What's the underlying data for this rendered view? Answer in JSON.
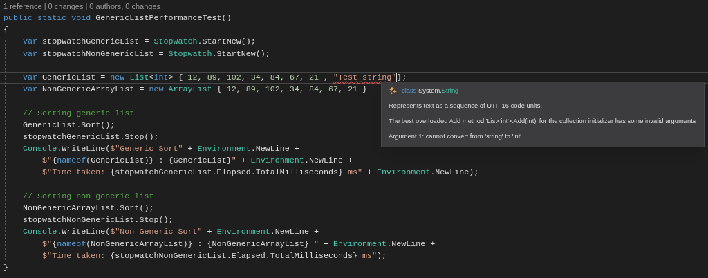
{
  "codelens": "1 reference | 0 changes | 0 authors, 0 changes",
  "lines": [
    {
      "kind": "code",
      "tokens": [
        {
          "kind": "kw",
          "text": "public static void "
        },
        {
          "kind": "plain",
          "text": "GenericListPerformanceTest()"
        }
      ]
    },
    {
      "kind": "code",
      "tokens": [
        {
          "kind": "plain",
          "text": "{"
        }
      ]
    },
    {
      "kind": "code",
      "tokens": [
        {
          "kind": "kw",
          "text": "    var "
        },
        {
          "kind": "plain",
          "text": "stopwatchGenericList = "
        },
        {
          "kind": "type",
          "text": "Stopwatch"
        },
        {
          "kind": "plain",
          "text": ".StartNew();"
        }
      ]
    },
    {
      "kind": "code",
      "tokens": [
        {
          "kind": "kw",
          "text": "    var "
        },
        {
          "kind": "plain",
          "text": "stopwatchNonGenericList = "
        },
        {
          "kind": "type",
          "text": "Stopwatch"
        },
        {
          "kind": "plain",
          "text": ".StartNew();"
        }
      ]
    },
    {
      "kind": "blank"
    },
    {
      "kind": "code",
      "current": true,
      "tokens": [
        {
          "kind": "kw",
          "text": "    var "
        },
        {
          "kind": "plain",
          "text": "GenericList = "
        },
        {
          "kind": "kw",
          "text": "new "
        },
        {
          "kind": "type",
          "text": "List"
        },
        {
          "kind": "plain",
          "text": "<"
        },
        {
          "kind": "kw",
          "text": "int"
        },
        {
          "kind": "plain",
          "text": "> { "
        },
        {
          "kind": "num",
          "text": "12"
        },
        {
          "kind": "plain",
          "text": ", "
        },
        {
          "kind": "num",
          "text": "89"
        },
        {
          "kind": "plain",
          "text": ", "
        },
        {
          "kind": "num",
          "text": "102"
        },
        {
          "kind": "plain",
          "text": ", "
        },
        {
          "kind": "num",
          "text": "34"
        },
        {
          "kind": "plain",
          "text": ", "
        },
        {
          "kind": "num",
          "text": "84"
        },
        {
          "kind": "plain",
          "text": ", "
        },
        {
          "kind": "num",
          "text": "67"
        },
        {
          "kind": "plain",
          "text": ", "
        },
        {
          "kind": "num",
          "text": "21"
        },
        {
          "kind": "plain",
          "text": " , "
        },
        {
          "kind": "error",
          "text": "\"Test string\""
        },
        {
          "kind": "plain",
          "text": "};"
        }
      ]
    },
    {
      "kind": "code",
      "tokens": [
        {
          "kind": "kw",
          "text": "    var "
        },
        {
          "kind": "plain",
          "text": "NonGenericArrayList = "
        },
        {
          "kind": "kw",
          "text": "new "
        },
        {
          "kind": "type",
          "text": "ArrayList"
        },
        {
          "kind": "plain",
          "text": " { "
        },
        {
          "kind": "num",
          "text": "12"
        },
        {
          "kind": "plain",
          "text": ", "
        },
        {
          "kind": "num",
          "text": "89"
        },
        {
          "kind": "plain",
          "text": ", "
        },
        {
          "kind": "num",
          "text": "102"
        },
        {
          "kind": "plain",
          "text": ", "
        },
        {
          "kind": "num",
          "text": "34"
        },
        {
          "kind": "plain",
          "text": ", "
        },
        {
          "kind": "num",
          "text": "84"
        },
        {
          "kind": "plain",
          "text": ", "
        },
        {
          "kind": "num",
          "text": "67"
        },
        {
          "kind": "plain",
          "text": ", "
        },
        {
          "kind": "num",
          "text": "21"
        },
        {
          "kind": "plain",
          "text": " }"
        }
      ]
    },
    {
      "kind": "blank"
    },
    {
      "kind": "code",
      "tokens": [
        {
          "kind": "comment",
          "text": "    // Sorting generic list"
        }
      ]
    },
    {
      "kind": "code",
      "tokens": [
        {
          "kind": "plain",
          "text": "    GenericList.Sort();"
        }
      ]
    },
    {
      "kind": "code",
      "tokens": [
        {
          "kind": "plain",
          "text": "    stopwatchGenericList.Stop();"
        }
      ]
    },
    {
      "kind": "code",
      "tokens": [
        {
          "kind": "type",
          "text": "    Console"
        },
        {
          "kind": "plain",
          "text": ".WriteLine("
        },
        {
          "kind": "str",
          "text": "$\"Generic Sort\""
        },
        {
          "kind": "plain",
          "text": " + "
        },
        {
          "kind": "type",
          "text": "Environment"
        },
        {
          "kind": "plain",
          "text": ".NewLine +"
        }
      ]
    },
    {
      "kind": "code",
      "tokens": [
        {
          "kind": "str",
          "text": "        $\""
        },
        {
          "kind": "plain",
          "text": "{"
        },
        {
          "kind": "kw",
          "text": "nameof"
        },
        {
          "kind": "plain",
          "text": "(GenericList)} : {GenericList}"
        },
        {
          "kind": "str",
          "text": "\""
        },
        {
          "kind": "plain",
          "text": " + "
        },
        {
          "kind": "type",
          "text": "Environment"
        },
        {
          "kind": "plain",
          "text": ".NewLine +"
        }
      ]
    },
    {
      "kind": "code",
      "tokens": [
        {
          "kind": "str",
          "text": "        $\"Time taken: "
        },
        {
          "kind": "plain",
          "text": "{stopwatchGenericList.Elapsed.TotalMilliseconds}"
        },
        {
          "kind": "str",
          "text": " ms\""
        },
        {
          "kind": "plain",
          "text": " + "
        },
        {
          "kind": "type",
          "text": "Environment"
        },
        {
          "kind": "plain",
          "text": ".NewLine);"
        }
      ]
    },
    {
      "kind": "blank"
    },
    {
      "kind": "code",
      "tokens": [
        {
          "kind": "comment",
          "text": "    // Sorting non generic list"
        }
      ]
    },
    {
      "kind": "code",
      "tokens": [
        {
          "kind": "plain",
          "text": "    NonGenericArrayList.Sort();"
        }
      ]
    },
    {
      "kind": "code",
      "tokens": [
        {
          "kind": "plain",
          "text": "    stopwatchNonGenericList.Stop();"
        }
      ]
    },
    {
      "kind": "code",
      "tokens": [
        {
          "kind": "type",
          "text": "    Console"
        },
        {
          "kind": "plain",
          "text": ".WriteLine("
        },
        {
          "kind": "str",
          "text": "$\"Non-Generic Sort\""
        },
        {
          "kind": "plain",
          "text": " + "
        },
        {
          "kind": "type",
          "text": "Environment"
        },
        {
          "kind": "plain",
          "text": ".NewLine +"
        }
      ]
    },
    {
      "kind": "code",
      "tokens": [
        {
          "kind": "str",
          "text": "        $\""
        },
        {
          "kind": "plain",
          "text": "{"
        },
        {
          "kind": "kw",
          "text": "nameof"
        },
        {
          "kind": "plain",
          "text": "(NonGenericArrayList)} : {NonGenericArrayList} "
        },
        {
          "kind": "str",
          "text": "\""
        },
        {
          "kind": "plain",
          "text": " + "
        },
        {
          "kind": "type",
          "text": "Environment"
        },
        {
          "kind": "plain",
          "text": ".NewLine +"
        }
      ]
    },
    {
      "kind": "code",
      "tokens": [
        {
          "kind": "str",
          "text": "        $\"Time taken: "
        },
        {
          "kind": "plain",
          "text": "{stopwatchNonGenericList.Elapsed.TotalMilliseconds}"
        },
        {
          "kind": "str",
          "text": " ms\""
        },
        {
          "kind": "plain",
          "text": ");"
        }
      ]
    },
    {
      "kind": "code",
      "tokens": [
        {
          "kind": "plain",
          "text": "}"
        }
      ]
    }
  ],
  "tooltip": {
    "header": [
      {
        "kind": "kw",
        "text": "class "
      },
      {
        "kind": "plain",
        "text": "System."
      },
      {
        "kind": "type",
        "text": "String"
      }
    ],
    "lines": [
      "Represents text as a sequence of UTF-16 code units.",
      "The best overloaded Add method 'List<int>.Add(int)' for the collection initializer has some invalid arguments",
      "Argument 1: cannot convert from 'string' to 'int'"
    ]
  }
}
